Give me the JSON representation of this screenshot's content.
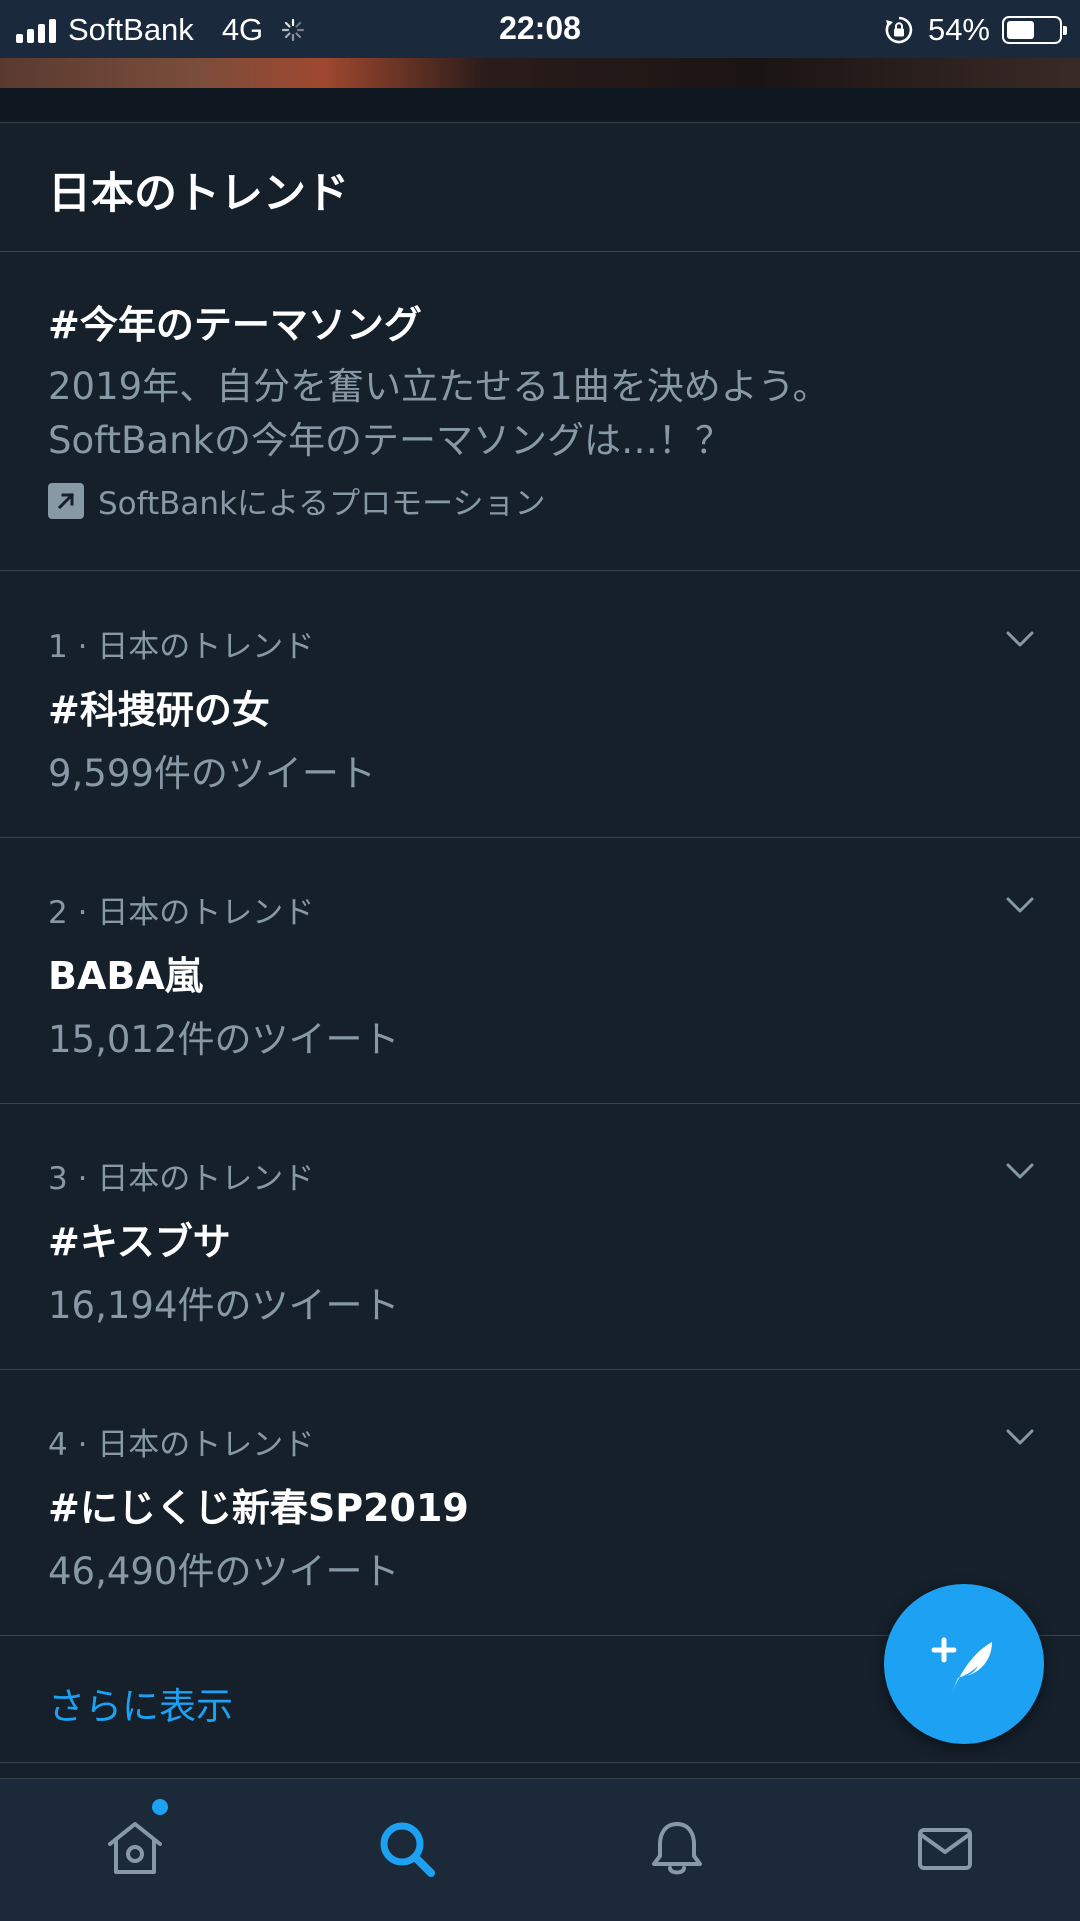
{
  "status_bar": {
    "carrier": "SoftBank",
    "network": "4G",
    "time": "22:08",
    "battery_percent": "54%",
    "battery_level": 0.54
  },
  "header": {
    "title": "日本のトレンド"
  },
  "promo": {
    "title": "#今年のテーマソング",
    "description_lines": [
      "2019年、自分を奮い立たせる1曲を決めよう。",
      "SoftBankの今年のテーマソングは…！？"
    ],
    "promoted_by": "SoftBankによるプロモーション",
    "icon": "promoted-arrow-icon"
  },
  "trends": [
    {
      "meta": "1 · 日本のトレンド",
      "name": "#科捜研の女",
      "count": "9,599件のツイート"
    },
    {
      "meta": "2 · 日本のトレンド",
      "name": "BABA嵐",
      "count": "15,012件のツイート"
    },
    {
      "meta": "3 · 日本のトレンド",
      "name": "#キスブサ",
      "count": "16,194件のツイート"
    },
    {
      "meta": "4 · 日本のトレンド",
      "name": "#にじくじ新春SP2019",
      "count": "46,490件のツイート"
    }
  ],
  "show_more": {
    "label": "さらに表示"
  },
  "fab": {
    "icon": "compose-tweet-icon"
  },
  "tab_bar": {
    "items": [
      "home-icon",
      "search-icon",
      "notifications-icon",
      "messages-icon"
    ],
    "active": "search-icon"
  },
  "colors": {
    "background": "#15202b",
    "accent": "#1da1f2",
    "secondary_text": "#8899a6",
    "divider": "#38444d"
  }
}
